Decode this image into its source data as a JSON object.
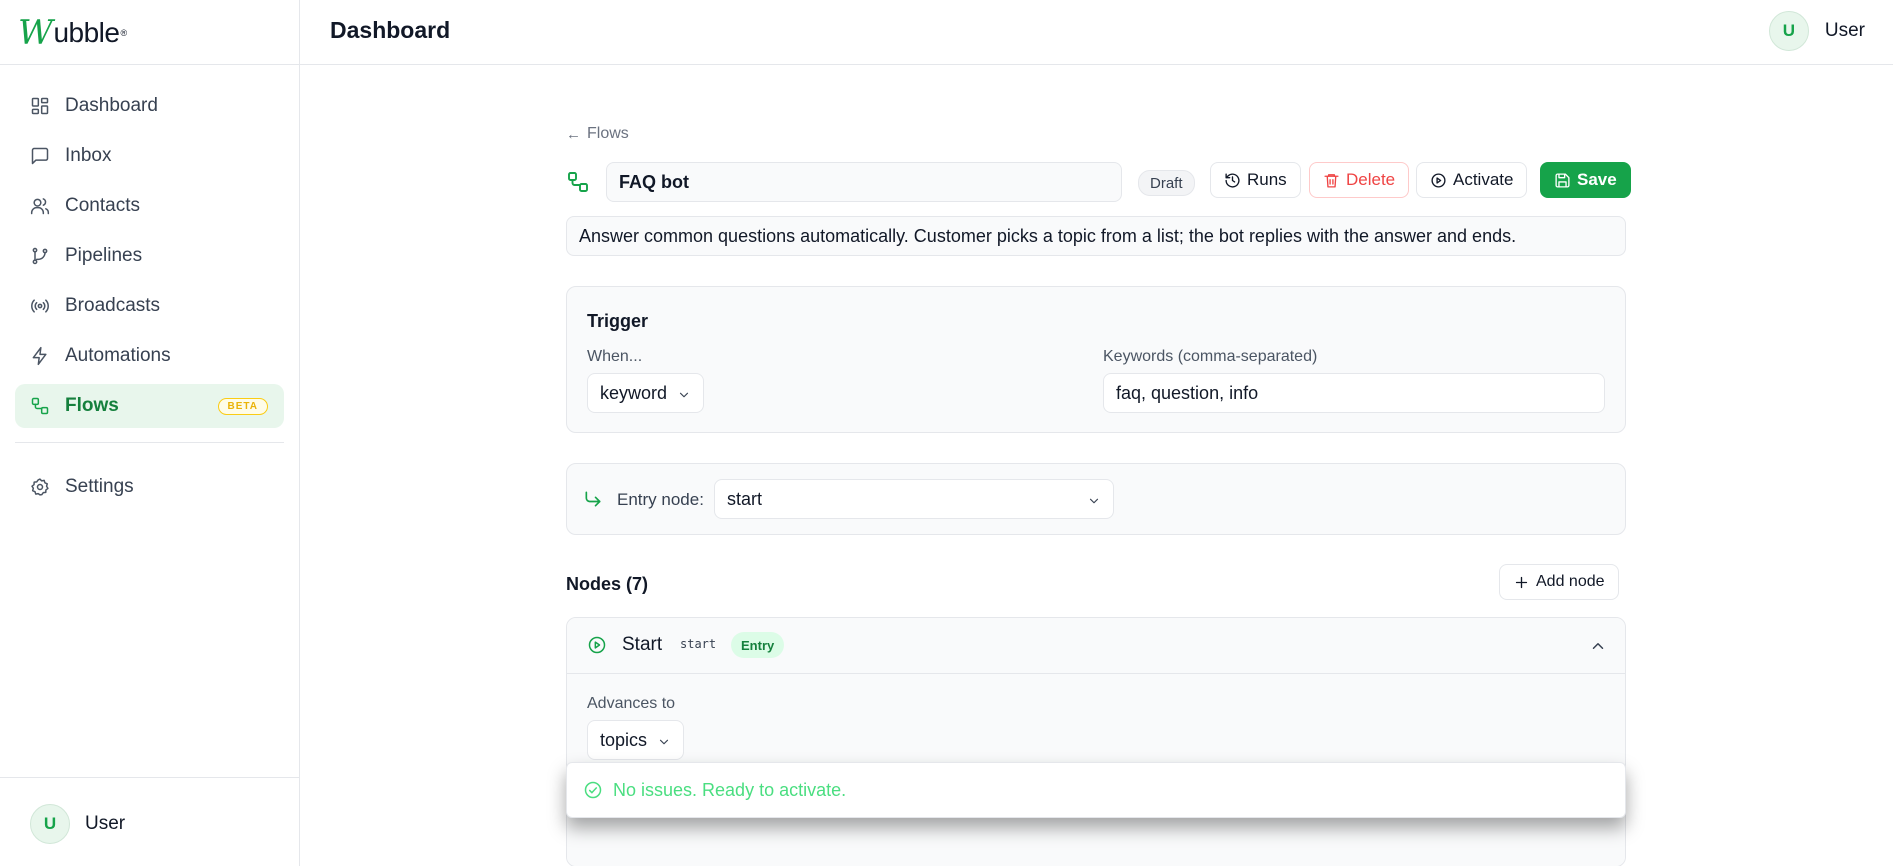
{
  "brand": {
    "logo_initial": "W",
    "logo_rest": "ubble",
    "logo_mark": "®"
  },
  "header": {
    "title": "Dashboard",
    "user_initial": "U",
    "user_name": "User"
  },
  "sidebar": {
    "items": [
      {
        "label": "Dashboard",
        "icon": "dashboard-icon"
      },
      {
        "label": "Inbox",
        "icon": "inbox-icon"
      },
      {
        "label": "Contacts",
        "icon": "contacts-icon"
      },
      {
        "label": "Pipelines",
        "icon": "pipelines-icon"
      },
      {
        "label": "Broadcasts",
        "icon": "broadcasts-icon"
      },
      {
        "label": "Automations",
        "icon": "automations-icon"
      },
      {
        "label": "Flows",
        "icon": "flows-icon",
        "badge": "BETA",
        "active": true
      }
    ],
    "settings_label": "Settings",
    "user_initial": "U",
    "user_name": "User"
  },
  "flow": {
    "back_label": "Flows",
    "name": "FAQ bot",
    "status": "Draft",
    "runs_label": "Runs",
    "delete_label": "Delete",
    "activate_label": "Activate",
    "save_label": "Save",
    "description": "Answer common questions automatically. Customer picks a topic from a list; the bot replies with the answer and ends."
  },
  "trigger": {
    "title": "Trigger",
    "when_label": "When...",
    "when_value": "keyword",
    "keywords_label": "Keywords (comma-separated)",
    "keywords_value": "faq, question, info"
  },
  "entry": {
    "label": "Entry node:",
    "value": "start"
  },
  "nodes": {
    "title": "Nodes (7)",
    "add_label": "Add node",
    "first": {
      "name": "Start",
      "id": "start",
      "badge": "Entry",
      "advances_label": "Advances to",
      "advances_value": "topics"
    }
  },
  "toast": {
    "message": "No issues. Ready to activate."
  },
  "colors": {
    "accent": "#16a34a",
    "danger": "#ef4444",
    "success_text": "#4ade80"
  }
}
